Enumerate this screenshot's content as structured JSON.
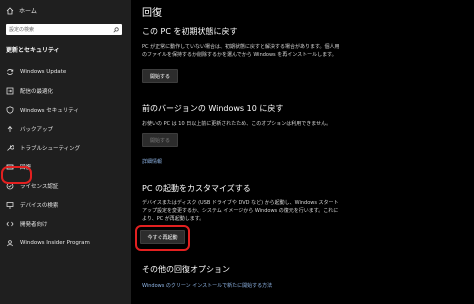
{
  "sidebar": {
    "home_label": "ホーム",
    "search_placeholder": "設定の検索",
    "section_title": "更新とセキュリティ",
    "items": [
      {
        "label": "Windows Update",
        "icon": "sync-icon"
      },
      {
        "label": "配信の最適化",
        "icon": "delivery-icon"
      },
      {
        "label": "Windows セキュリティ",
        "icon": "shield-icon"
      },
      {
        "label": "バックアップ",
        "icon": "backup-icon"
      },
      {
        "label": "トラブルシューティング",
        "icon": "wrench-icon"
      },
      {
        "label": "回復",
        "icon": "recovery-icon",
        "active": true
      },
      {
        "label": "ライセンス認証",
        "icon": "check-circle-icon"
      },
      {
        "label": "デバイスの検索",
        "icon": "find-device-icon"
      },
      {
        "label": "開発者向け",
        "icon": "developer-icon"
      },
      {
        "label": "Windows Insider Program",
        "icon": "insider-icon"
      }
    ]
  },
  "main": {
    "title": "回復",
    "reset": {
      "heading": "この PC を初期状態に戻す",
      "desc": "PC が正常に動作していない場合は、初期状態に戻すと解決する場合があります。個人用のファイルを保持するか削除するかを選んでから Windows を再インストールします。",
      "button": "開始する"
    },
    "rollback": {
      "heading": "前のバージョンの Windows 10 に戻す",
      "desc": "お使いの PC は 10 日以上前に更新されたため、このオプションは利用できません。",
      "button": "開始する",
      "link": "詳細情報"
    },
    "startup": {
      "heading": "PC の起動をカスタマイズする",
      "desc": "デバイスまたはディスク (USB ドライブや DVD など) から起動し、Windows スタートアップ設定を変更するか、システム イメージから Windows の復元を行います。これにより、PC が再起動します。",
      "button": "今すぐ再起動"
    },
    "other": {
      "heading": "その他の回復オプション",
      "link": "Windows のクリーン インストールで新たに開始する方法"
    }
  },
  "colors": {
    "accent_ring": "#e32020",
    "link": "#8fb5e6"
  }
}
